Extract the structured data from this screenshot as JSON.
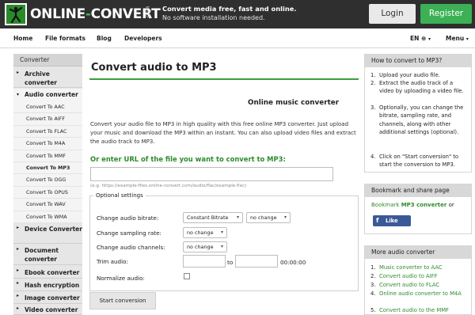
{
  "header": {
    "logo": {
      "word_left": "ONLINE",
      "word_dash": "-",
      "word_right": "CONVERT",
      "suffix": ".COM"
    },
    "tagline_1": "Convert media free, fast and online.",
    "tagline_2": "No software installation needed.",
    "login_label": "Login",
    "register_label": "Register",
    "colors": {
      "topbar": "#2f2f2f",
      "register": "#3cb054",
      "accent": "#3b9e3b"
    }
  },
  "nav": {
    "items": [
      "Home",
      "File formats",
      "Blog",
      "Developers"
    ],
    "language": "EN",
    "globe_icon": "globe-icon",
    "menu_label": "Menu"
  },
  "sidebar": {
    "title": "Converter",
    "categories_top": [
      {
        "label": "Archive converter"
      }
    ],
    "audio_label": "Audio converter",
    "audio_items": [
      "Convert To AAC",
      "Convert To AIFF",
      "Convert To FLAC",
      "Convert To M4A",
      "Convert To MMF",
      "Convert To MP3",
      "Convert To OGG",
      "Convert To OPUS",
      "Convert To WAV",
      "Convert To WMA"
    ],
    "active_item": "Convert To MP3",
    "categories_bottom": [
      {
        "label": "Device Converter"
      },
      {
        "label": "Document converter"
      },
      {
        "label": "Ebook converter"
      },
      {
        "label": "Hash encryption"
      },
      {
        "label": "Image converter"
      },
      {
        "label": "Video converter"
      }
    ]
  },
  "main": {
    "title": "Convert audio to MP3",
    "subtitle": "Online music converter",
    "intro": "Convert your audio file to MP3 in high quality with this free online MP3 converter. Just upload your music and download the MP3 within an instant. You can also upload video files and extract the audio track to MP3.",
    "url_label": "Or enter URL of the file you want to convert to MP3:",
    "url_value": "",
    "url_example": "(e.g. https://example-files.online-convert.com/audio/flac/example.flac)",
    "optional_settings": {
      "legend": "Optional settings",
      "bitrate_label": "Change audio bitrate:",
      "bitrate_mode": "Constant Bitrate",
      "bitrate_value": "no change",
      "sampling_label": "Change sampling rate:",
      "sampling_value": "no change",
      "channels_label": "Change audio channels:",
      "channels_value": "no change",
      "trim_label": "Trim audio:",
      "trim_to": "to",
      "trim_time": "00:00:00",
      "normalize_label": "Normalize audio:",
      "normalize_checked": false
    },
    "start_button": "Start conversion"
  },
  "right": {
    "howto_title": "How to convert to MP3?",
    "howto_steps": [
      "Upload your audio file.",
      "Extract the audio track of a video by uploading a video file.",
      "Optionally, you can change the bitrate, sampling rate, and channels, along with other additional settings (optional).",
      "Click on \"Start conversion\" to start the conversion to MP3."
    ],
    "bookmark_title": "Bookmark and share page",
    "bookmark_text_1": "Bookmark",
    "bookmark_text_bold": "MP3 converter",
    "bookmark_text_2": "or",
    "like_label": "Like",
    "more_title": "More audio converter",
    "more_items": [
      "Music converter to AAC",
      "Convert audio to AIFF",
      "Convert audio to FLAC",
      "Online audio converter to M4A",
      "Convert audio to the MMF"
    ]
  }
}
